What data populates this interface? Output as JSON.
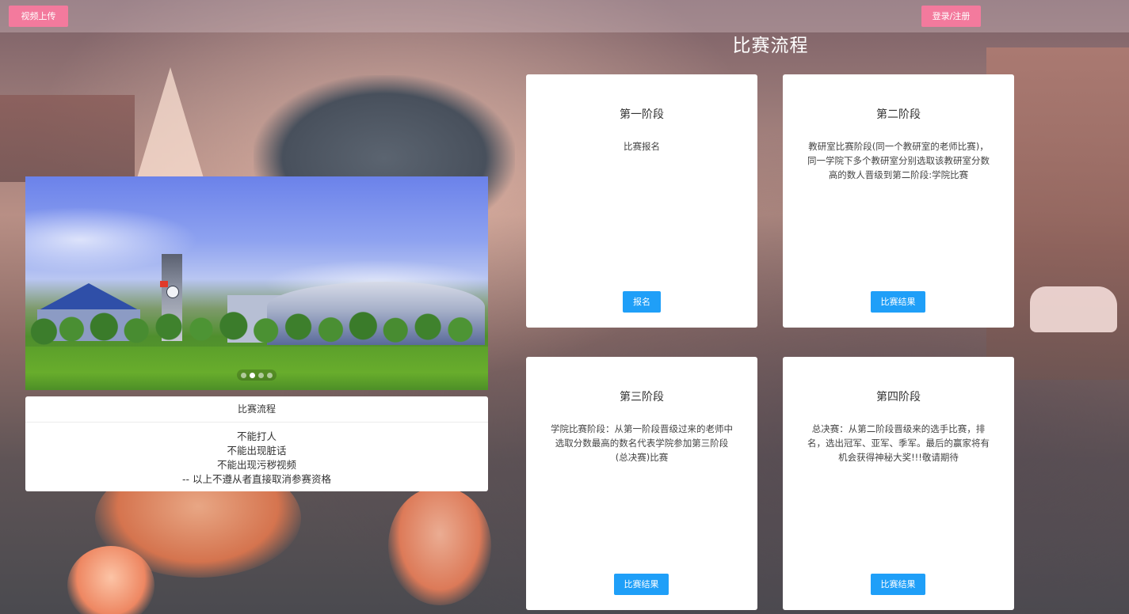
{
  "header": {
    "upload_button": "视频上传",
    "login_button": "登录/注册"
  },
  "page_title": "比赛流程",
  "carousel": {
    "slide_count": 4,
    "active_index": 1
  },
  "rules": {
    "title": "比赛流程",
    "lines": [
      "不能打人",
      "不能出现脏话",
      "不能出现污秽视频",
      "-- 以上不遵从者直接取消参赛资格"
    ]
  },
  "stages": [
    {
      "title": "第一阶段",
      "description": "比赛报名",
      "button": "报名"
    },
    {
      "title": "第二阶段",
      "description": "教研室比赛阶段(同一个教研室的老师比赛)，同一学院下多个教研室分别选取该教研室分数高的数人晋级到第二阶段:学院比赛",
      "button": "比赛结果"
    },
    {
      "title": "第三阶段",
      "description": "学院比赛阶段：从第一阶段晋级过来的老师中选取分数最高的数名代表学院参加第三阶段(总决赛)比赛",
      "button": "比赛结果"
    },
    {
      "title": "第四阶段",
      "description": "总决赛：从第二阶段晋级来的选手比赛，排名，选出冠军、亚军、季军。最后的赢家将有机会获得神秘大奖!!!敬请期待",
      "button": "比赛结果"
    }
  ],
  "colors": {
    "header_button": "#f37a9d",
    "stage_button": "#1f9ff8"
  }
}
